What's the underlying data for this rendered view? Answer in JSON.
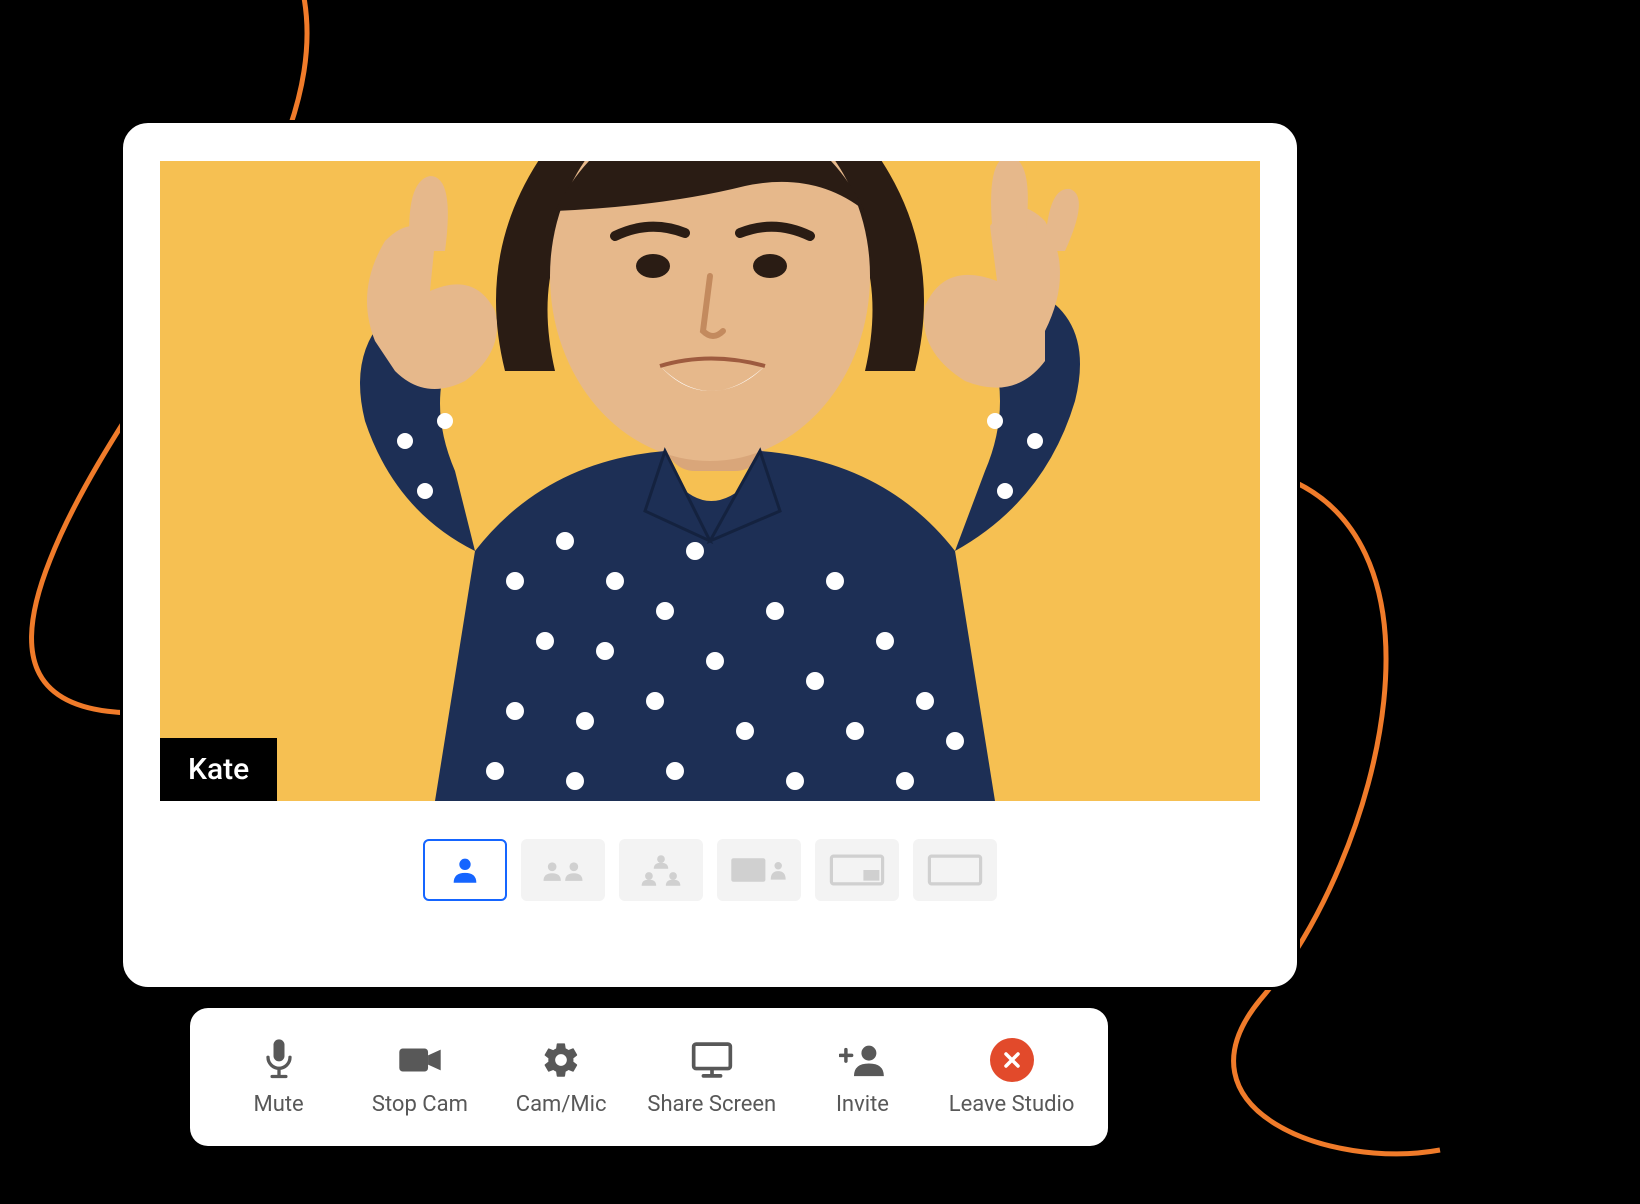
{
  "participant": {
    "name": "Kate"
  },
  "colors": {
    "video_bg": "#f6c052",
    "accent": "#1565ff",
    "leave": "#e24a2b",
    "swirl": "#f07b2a"
  },
  "layouts": {
    "active_index": 0,
    "count": 6
  },
  "toolbar": {
    "mute": "Mute",
    "stop_cam": "Stop Cam",
    "cam_mic": "Cam/Mic",
    "share_screen": "Share Screen",
    "invite": "Invite",
    "leave": "Leave Studio"
  }
}
